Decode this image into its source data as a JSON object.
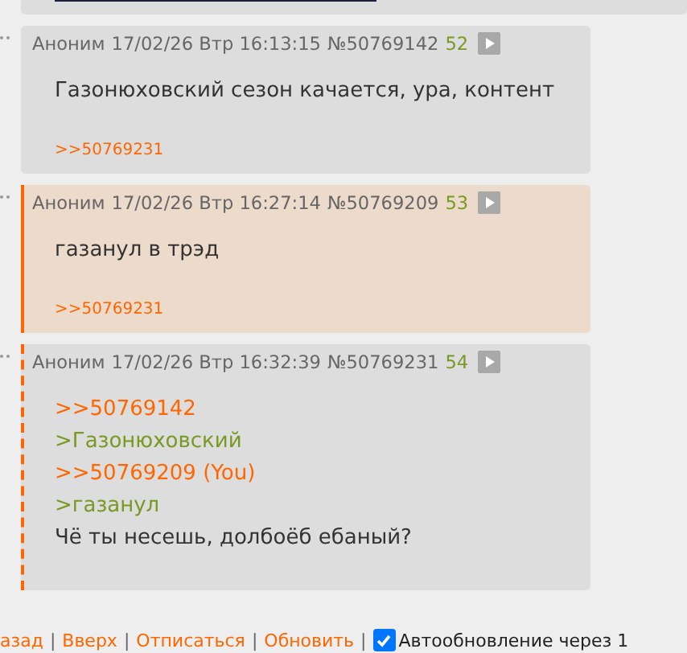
{
  "posts": [
    {
      "kind": "normal",
      "author": "Аноним",
      "date": "17/02/26 Втр 16:13:15",
      "number": "№50769142",
      "index": "52",
      "body": [
        {
          "kind": "text",
          "text": "Газонюховский сезон качается, ура, контент"
        }
      ],
      "replies": [
        ">>50769231"
      ]
    },
    {
      "kind": "own",
      "author": "Аноним",
      "date": "17/02/26 Втр 16:27:14",
      "number": "№50769209",
      "index": "53",
      "body": [
        {
          "kind": "text",
          "text": "газанул в трэд"
        }
      ],
      "replies": [
        ">>50769231"
      ]
    },
    {
      "kind": "reply",
      "author": "Аноним",
      "date": "17/02/26 Втр 16:32:39",
      "number": "№50769231",
      "index": "54",
      "body": [
        {
          "kind": "link",
          "text": ">>50769142"
        },
        {
          "kind": "quote",
          "text": ">Газонюховский"
        },
        {
          "kind": "link",
          "text": ">>50769209 (You)"
        },
        {
          "kind": "quote",
          "text": ">газанул"
        },
        {
          "kind": "text",
          "text": "Чё ты несешь, долбоёб ебаный?"
        }
      ]
    }
  ],
  "footer": {
    "links": [
      "азад",
      "Вверх",
      "Отписаться",
      "Обновить"
    ],
    "separator": "|",
    "autoupdate": {
      "checked": true,
      "label": "Автообновление через 1"
    }
  }
}
